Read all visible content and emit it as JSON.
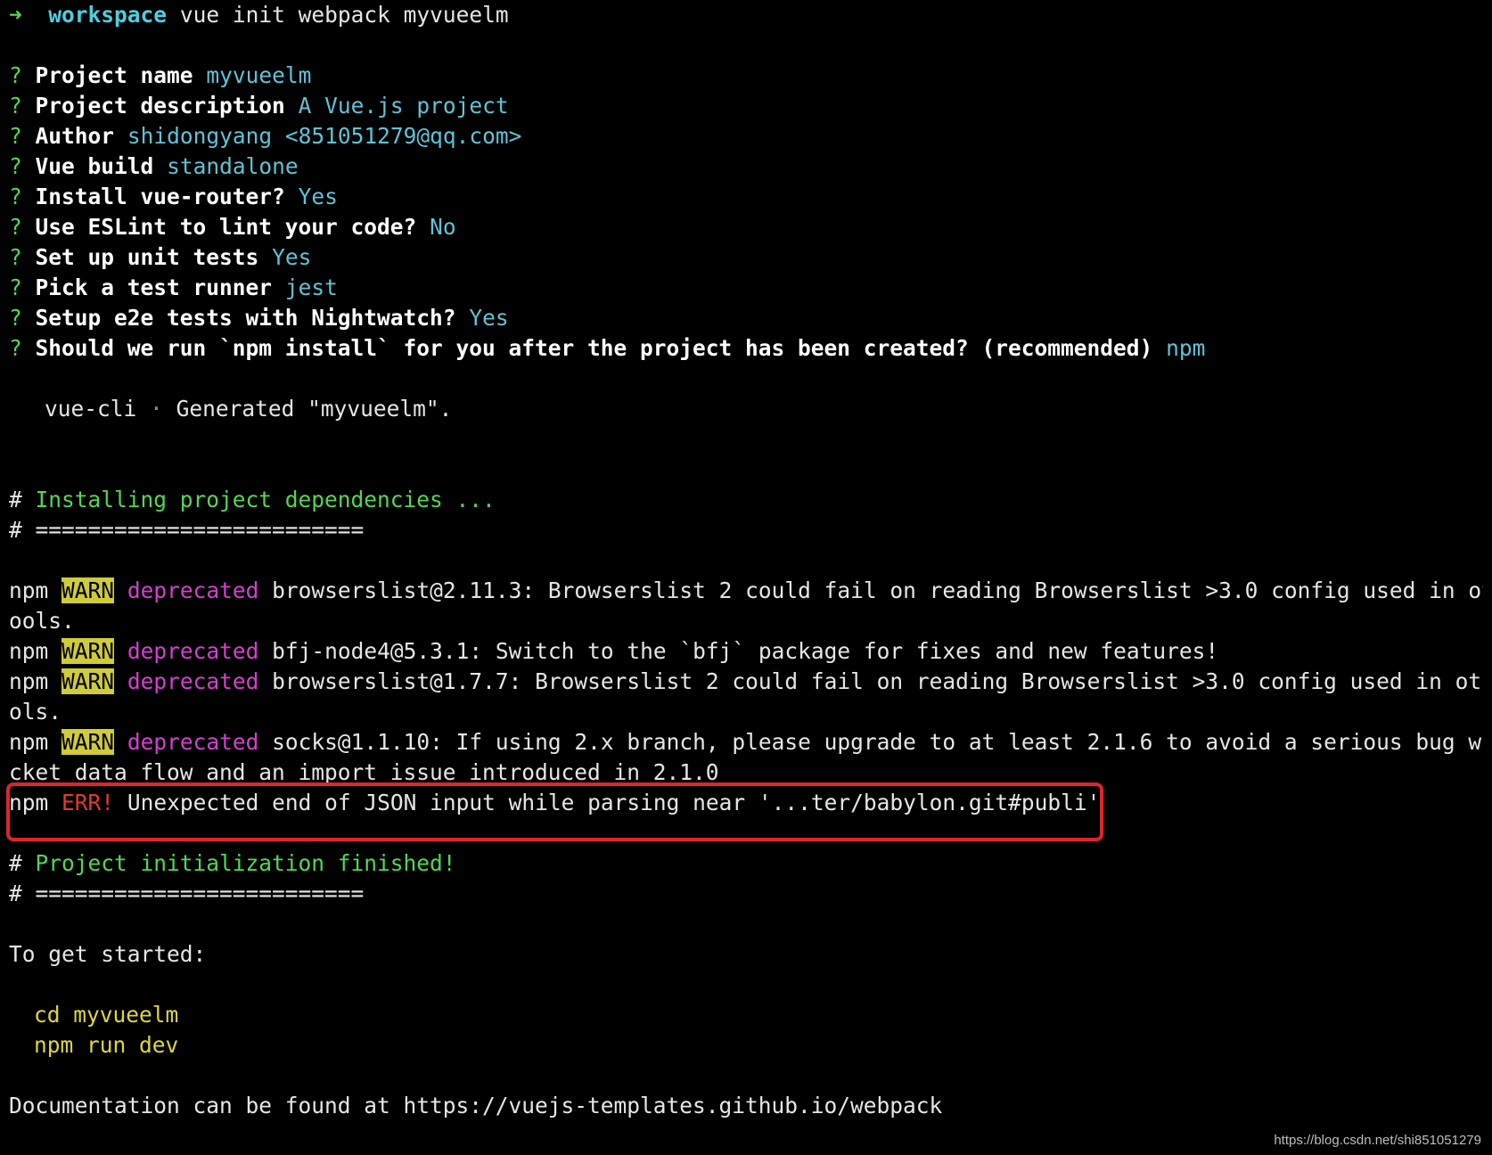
{
  "prompt": {
    "arrow": "➜",
    "dir": "workspace",
    "command": "vue init webpack myvueelm"
  },
  "qa": [
    {
      "mark": "?",
      "q": "Project name",
      "a": "myvueelm"
    },
    {
      "mark": "?",
      "q": "Project description",
      "a": "A Vue.js project"
    },
    {
      "mark": "?",
      "q": "Author",
      "a": "shidongyang <851051279@qq.com>"
    },
    {
      "mark": "?",
      "q": "Vue build",
      "a": "standalone"
    },
    {
      "mark": "?",
      "q": "Install vue-router?",
      "a": "Yes"
    },
    {
      "mark": "?",
      "q": "Use ESLint to lint your code?",
      "a": "No"
    },
    {
      "mark": "?",
      "q": "Set up unit tests",
      "a": "Yes"
    },
    {
      "mark": "?",
      "q": "Pick a test runner",
      "a": "jest"
    },
    {
      "mark": "?",
      "q": "Setup e2e tests with Nightwatch?",
      "a": "Yes"
    },
    {
      "mark": "?",
      "q": "Should we run `npm install` for you after the project has been created? (recommended)",
      "a": "npm"
    }
  ],
  "generated": {
    "tool": "vue-cli",
    "sep": "·",
    "msg": "Generated \"myvueelm\"."
  },
  "installing": {
    "hash": "#",
    "title": "Installing project dependencies ...",
    "rule": "========================="
  },
  "warnings": [
    {
      "npm": "npm",
      "level": "WARN",
      "tag": "deprecated",
      "text": "browserslist@2.11.3: Browserslist 2 could fail on reading Browserslist >3.0 config used in other t",
      "cont": "ools."
    },
    {
      "npm": "npm",
      "level": "WARN",
      "tag": "deprecated",
      "text": "bfj-node4@5.3.1: Switch to the `bfj` package for fixes and new features!",
      "cont": ""
    },
    {
      "npm": "npm",
      "level": "WARN",
      "tag": "deprecated",
      "text": "browserslist@1.7.7: Browserslist 2 could fail on reading Browserslist >3.0 config used in other to",
      "cont": "ols."
    },
    {
      "npm": "npm",
      "level": "WARN",
      "tag": "deprecated",
      "text": "socks@1.1.10: If using 2.x branch, please upgrade to at least 2.1.6 to avoid a serious bug with so",
      "cont": "cket data flow and an import issue introduced in 2.1.0"
    }
  ],
  "error": {
    "npm": "npm",
    "level": "ERR!",
    "text": "Unexpected end of JSON input while parsing near '...ter/babylon.git#publi'"
  },
  "finished": {
    "hash": "#",
    "title": "Project initialization finished!",
    "rule": "========================="
  },
  "getstarted": {
    "title": "To get started:",
    "cmd1": "cd myvueelm",
    "cmd2": "npm run dev"
  },
  "docs": "Documentation can be found at https://vuejs-templates.github.io/webpack",
  "watermark": "https://blog.csdn.net/shi851051279"
}
